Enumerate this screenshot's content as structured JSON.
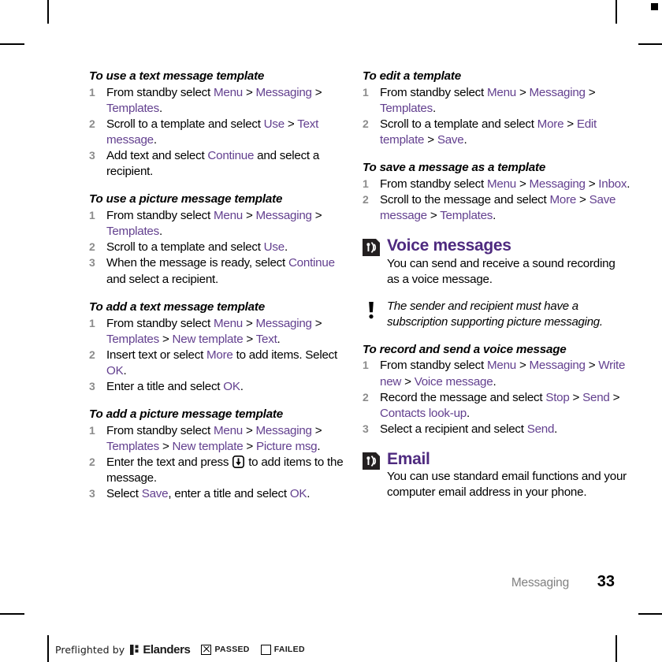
{
  "document": {
    "chapter": "Messaging",
    "page_number": "33"
  },
  "left_column": {
    "blocks": [
      {
        "kind": "procedure",
        "title": "To use a text message template",
        "steps": [
          [
            {
              "t": "From standby select ",
              "s": "n"
            },
            {
              "t": "Menu",
              "s": "m"
            },
            {
              "t": " > ",
              "s": "n"
            },
            {
              "t": "Messaging",
              "s": "m"
            },
            {
              "t": " > ",
              "s": "n"
            },
            {
              "t": "Templates",
              "s": "m"
            },
            {
              "t": ".",
              "s": "n"
            }
          ],
          [
            {
              "t": "Scroll to a template and select ",
              "s": "n"
            },
            {
              "t": "Use",
              "s": "m"
            },
            {
              "t": " > ",
              "s": "n"
            },
            {
              "t": "Text message",
              "s": "m"
            },
            {
              "t": ".",
              "s": "n"
            }
          ],
          [
            {
              "t": "Add text and select ",
              "s": "n"
            },
            {
              "t": "Continue",
              "s": "m"
            },
            {
              "t": " and select a recipient.",
              "s": "n"
            }
          ]
        ]
      },
      {
        "kind": "procedure",
        "title": "To use a picture message template",
        "steps": [
          [
            {
              "t": "From standby select ",
              "s": "n"
            },
            {
              "t": "Menu",
              "s": "m"
            },
            {
              "t": " > ",
              "s": "n"
            },
            {
              "t": "Messaging",
              "s": "m"
            },
            {
              "t": " > ",
              "s": "n"
            },
            {
              "t": "Templates",
              "s": "m"
            },
            {
              "t": ".",
              "s": "n"
            }
          ],
          [
            {
              "t": "Scroll to a template and select ",
              "s": "n"
            },
            {
              "t": "Use",
              "s": "m"
            },
            {
              "t": ".",
              "s": "n"
            }
          ],
          [
            {
              "t": "When the message is ready, select ",
              "s": "n"
            },
            {
              "t": "Continue",
              "s": "m"
            },
            {
              "t": " and select a recipient.",
              "s": "n"
            }
          ]
        ]
      },
      {
        "kind": "procedure",
        "title": "To add a text message template",
        "steps": [
          [
            {
              "t": "From standby select ",
              "s": "n"
            },
            {
              "t": "Menu",
              "s": "m"
            },
            {
              "t": " > ",
              "s": "n"
            },
            {
              "t": "Messaging",
              "s": "m"
            },
            {
              "t": " > ",
              "s": "n"
            },
            {
              "t": "Templates",
              "s": "m"
            },
            {
              "t": " > ",
              "s": "n"
            },
            {
              "t": "New template",
              "s": "m"
            },
            {
              "t": " > ",
              "s": "n"
            },
            {
              "t": "Text",
              "s": "m"
            },
            {
              "t": ".",
              "s": "n"
            }
          ],
          [
            {
              "t": "Insert text or select ",
              "s": "n"
            },
            {
              "t": "More",
              "s": "m"
            },
            {
              "t": " to add items. Select ",
              "s": "n"
            },
            {
              "t": "OK",
              "s": "m"
            },
            {
              "t": ".",
              "s": "n"
            }
          ],
          [
            {
              "t": "Enter a title and select ",
              "s": "n"
            },
            {
              "t": "OK",
              "s": "m"
            },
            {
              "t": ".",
              "s": "n"
            }
          ]
        ]
      },
      {
        "kind": "procedure",
        "title": "To add a picture message template",
        "steps": [
          [
            {
              "t": "From standby select ",
              "s": "n"
            },
            {
              "t": "Menu",
              "s": "m"
            },
            {
              "t": " > ",
              "s": "n"
            },
            {
              "t": "Messaging",
              "s": "m"
            },
            {
              "t": " > ",
              "s": "n"
            },
            {
              "t": "Templates",
              "s": "m"
            },
            {
              "t": " > ",
              "s": "n"
            },
            {
              "t": "New template",
              "s": "m"
            },
            {
              "t": " > ",
              "s": "n"
            },
            {
              "t": "Picture msg",
              "s": "m"
            },
            {
              "t": ".",
              "s": "n"
            }
          ],
          [
            {
              "t": "Enter the text and press ",
              "s": "n"
            },
            {
              "t": "",
              "s": "key"
            },
            {
              "t": " to add items to the message.",
              "s": "n"
            }
          ],
          [
            {
              "t": "Select ",
              "s": "n"
            },
            {
              "t": "Save",
              "s": "m"
            },
            {
              "t": ", enter a title and select ",
              "s": "n"
            },
            {
              "t": "OK",
              "s": "m"
            },
            {
              "t": ".",
              "s": "n"
            }
          ]
        ]
      }
    ]
  },
  "right_column": {
    "blocks": [
      {
        "kind": "procedure",
        "title": "To edit a template",
        "steps": [
          [
            {
              "t": "From standby select ",
              "s": "n"
            },
            {
              "t": "Menu",
              "s": "m"
            },
            {
              "t": " > ",
              "s": "n"
            },
            {
              "t": "Messaging",
              "s": "m"
            },
            {
              "t": " > ",
              "s": "n"
            },
            {
              "t": "Templates",
              "s": "m"
            },
            {
              "t": ".",
              "s": "n"
            }
          ],
          [
            {
              "t": "Scroll to a template and select ",
              "s": "n"
            },
            {
              "t": "More",
              "s": "m"
            },
            {
              "t": " > ",
              "s": "n"
            },
            {
              "t": "Edit template",
              "s": "m"
            },
            {
              "t": " > ",
              "s": "n"
            },
            {
              "t": "Save",
              "s": "m"
            },
            {
              "t": ".",
              "s": "n"
            }
          ]
        ]
      },
      {
        "kind": "procedure",
        "title": "To save a message as a template",
        "steps": [
          [
            {
              "t": "From standby select ",
              "s": "n"
            },
            {
              "t": "Menu",
              "s": "m"
            },
            {
              "t": " > ",
              "s": "n"
            },
            {
              "t": "Messaging",
              "s": "m"
            },
            {
              "t": " > ",
              "s": "n"
            },
            {
              "t": "Inbox",
              "s": "m"
            },
            {
              "t": ".",
              "s": "n"
            }
          ],
          [
            {
              "t": "Scroll to the message and select ",
              "s": "n"
            },
            {
              "t": "More",
              "s": "m"
            },
            {
              "t": " > ",
              "s": "n"
            },
            {
              "t": "Save message",
              "s": "m"
            },
            {
              "t": " > ",
              "s": "n"
            },
            {
              "t": "Templates",
              "s": "m"
            },
            {
              "t": ".",
              "s": "n"
            }
          ]
        ]
      },
      {
        "kind": "section",
        "icon": "voice-message-icon",
        "title": "Voice messages",
        "lead": "You can send and receive a sound recording as a voice message."
      },
      {
        "kind": "note",
        "icon": "exclamation-icon",
        "text": "The sender and recipient must have a subscription supporting picture messaging."
      },
      {
        "kind": "procedure",
        "title": "To record and send a voice message",
        "steps": [
          [
            {
              "t": "From standby select ",
              "s": "n"
            },
            {
              "t": "Menu",
              "s": "m"
            },
            {
              "t": " > ",
              "s": "n"
            },
            {
              "t": "Messaging",
              "s": "m"
            },
            {
              "t": " > ",
              "s": "n"
            },
            {
              "t": "Write new",
              "s": "m"
            },
            {
              "t": " > ",
              "s": "n"
            },
            {
              "t": "Voice message",
              "s": "m"
            },
            {
              "t": ".",
              "s": "n"
            }
          ],
          [
            {
              "t": "Record the message and select ",
              "s": "n"
            },
            {
              "t": "Stop",
              "s": "m"
            },
            {
              "t": " > ",
              "s": "n"
            },
            {
              "t": "Send",
              "s": "m"
            },
            {
              "t": " > ",
              "s": "n"
            },
            {
              "t": "Contacts look-up",
              "s": "m"
            },
            {
              "t": ".",
              "s": "n"
            }
          ],
          [
            {
              "t": "Select a recipient and select ",
              "s": "n"
            },
            {
              "t": "Send",
              "s": "m"
            },
            {
              "t": ".",
              "s": "n"
            }
          ]
        ]
      },
      {
        "kind": "section",
        "icon": "email-icon",
        "title": "Email",
        "lead": "You can use standard email functions and your computer email address in your phone."
      }
    ]
  },
  "preflight": {
    "label": "Preflighted by",
    "brand": "Elanders",
    "passed_label": "PASSED",
    "failed_label": "FAILED",
    "passed_checked": true,
    "failed_checked": false
  },
  "colors": {
    "menu_purple": "#63408f",
    "heading_purple": "#4e2a7f",
    "step_number_gray": "#8c8c8c",
    "chapter_gray": "#808080",
    "body_black": "#000000"
  }
}
